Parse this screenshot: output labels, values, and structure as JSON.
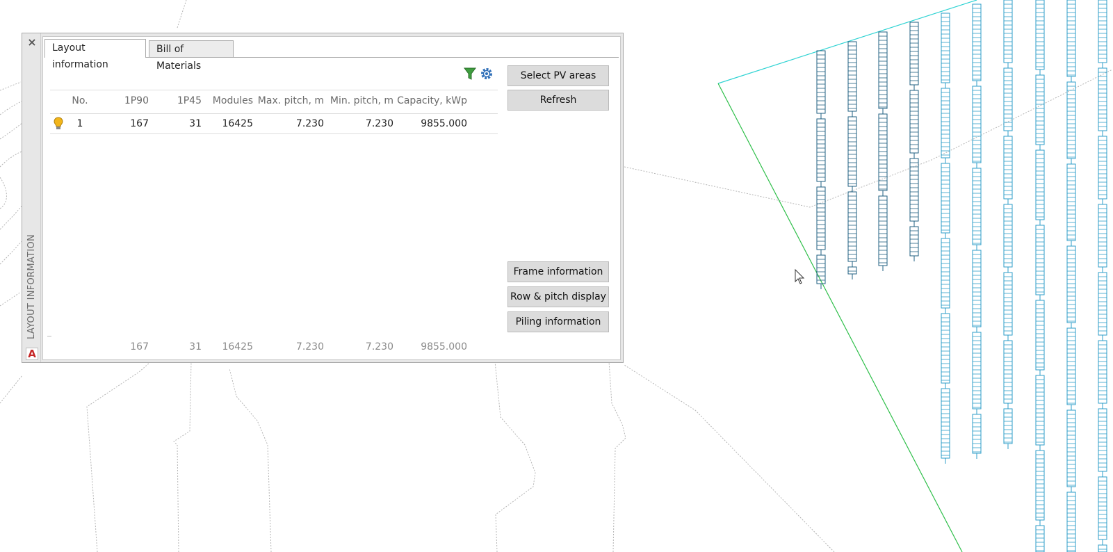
{
  "palette": {
    "side_title": "LAYOUT INFORMATION",
    "close_symbol": "×",
    "app_icon_letter": "A",
    "tabs": [
      {
        "label": "Layout information",
        "active": true
      },
      {
        "label": "Bill of Materials",
        "active": false
      }
    ],
    "toolbar": {
      "filter_icon": "filter-icon",
      "settings_icon": "gear-icon",
      "filter_color": "#3f9d3f",
      "settings_color": "#2f6fb8"
    },
    "table": {
      "columns": [
        "No.",
        "1P90",
        "1P45",
        "Modules",
        "Max. pitch, m",
        "Min. pitch, m",
        "Capacity, kWp"
      ],
      "rows": [
        {
          "visible_icon": "lightbulb-icon",
          "no": "1",
          "p90": "167",
          "p45": "31",
          "modules": "16425",
          "max_pitch": "7.230",
          "min_pitch": "7.230",
          "capacity": "9855.000"
        }
      ],
      "totals": {
        "p90": "167",
        "p45": "31",
        "modules": "16425",
        "max_pitch": "7.230",
        "min_pitch": "7.230",
        "capacity": "9855.000"
      }
    },
    "buttons": {
      "select_pv_areas": "Select PV areas",
      "refresh": "Refresh",
      "frame_information": "Frame information",
      "row_pitch_display": "Row & pitch display",
      "piling_information": "Piling information"
    }
  },
  "drawing": {
    "boundary_line_colors": [
      "#2fd3d3",
      "#2fbf4a"
    ],
    "module_outline_color_dark": "#1f5f80",
    "module_outline_color_light": "#2c9dc8",
    "contour_color": "#b5b5b5"
  }
}
